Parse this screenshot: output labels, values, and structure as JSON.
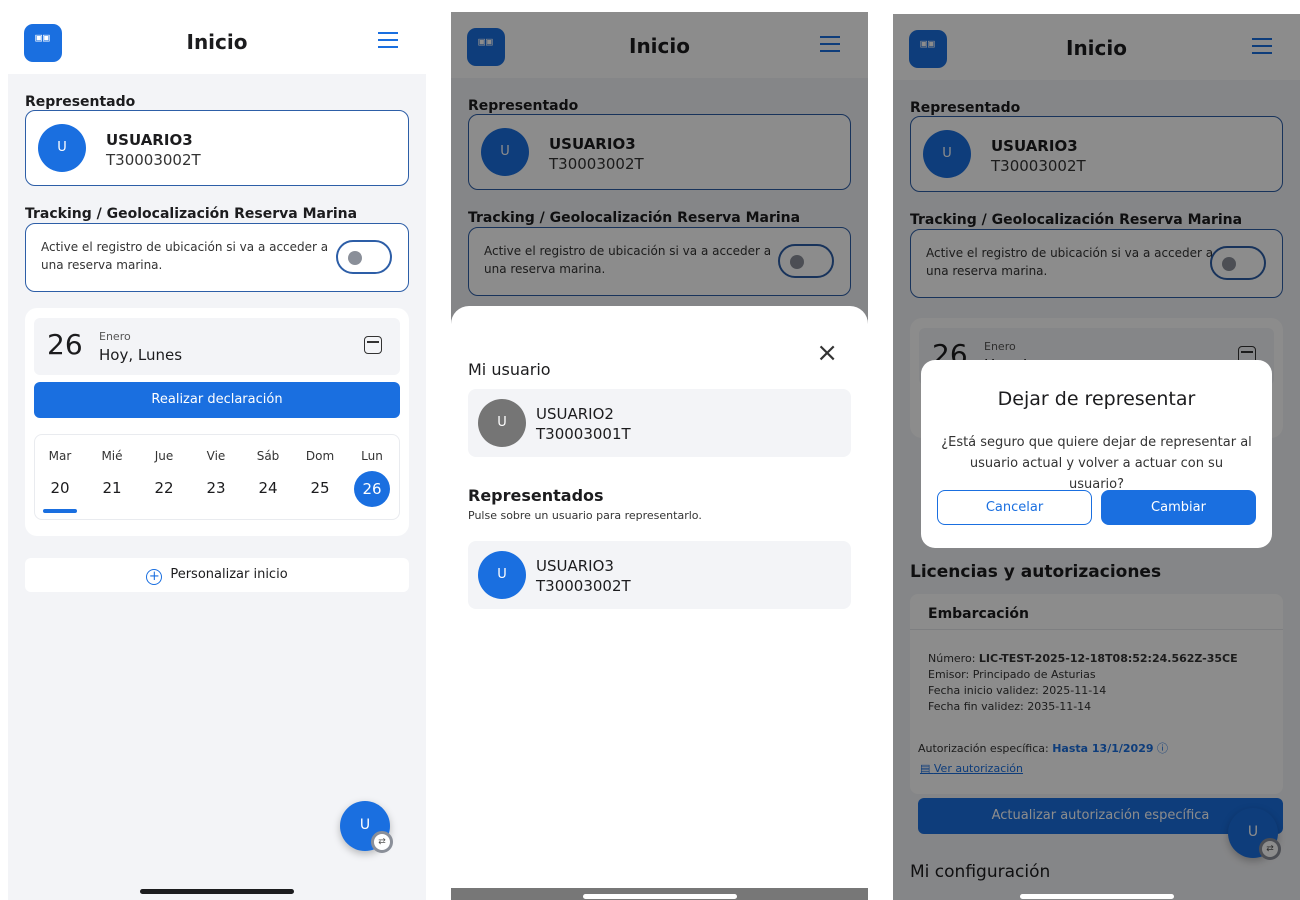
{
  "header": {
    "title": "Inicio",
    "logo_text": "OIO\nOIS"
  },
  "represented": {
    "section": "Representado",
    "avatar": "U",
    "name": "USUARIO3",
    "nif": "T30003002T"
  },
  "tracking": {
    "section": "Tracking / Geolocalización Reserva Marina",
    "text": "Active el registro de ubicación si va a acceder a una reserva marina."
  },
  "date": {
    "day_number": "26",
    "month": "Enero",
    "label": "Hoy, Lunes",
    "declare_button": "Realizar declaración",
    "week": [
      {
        "name": "Mar",
        "num": "20"
      },
      {
        "name": "Mié",
        "num": "21"
      },
      {
        "name": "Jue",
        "num": "22"
      },
      {
        "name": "Vie",
        "num": "23"
      },
      {
        "name": "Sáb",
        "num": "24"
      },
      {
        "name": "Dom",
        "num": "25"
      },
      {
        "name": "Lun",
        "num": "26"
      }
    ]
  },
  "customize": "Personalizar inicio",
  "fab": "U",
  "sheet": {
    "my_user_title": "Mi usuario",
    "my_user": {
      "avatar": "U",
      "name": "USUARIO2",
      "nif": "T30003001T"
    },
    "represented_title": "Representados",
    "represented_hint": "Pulse sobre un usuario para representarlo.",
    "represented_user": {
      "avatar": "U",
      "name": "USUARIO3",
      "nif": "T30003002T"
    },
    "close": "×"
  },
  "modal": {
    "title": "Dejar de representar",
    "text": "¿Está seguro que quiere dejar de representar al usuario actual y volver a actuar con su usuario?",
    "cancel": "Cancelar",
    "confirm": "Cambiar"
  },
  "licenses": {
    "section": "Licencias y autorizaciones",
    "type": "Embarcación",
    "number_label": "Número: ",
    "number": "LIC-TEST-2025-12-18T08:52:24.562Z-35CE",
    "issuer_label": "Emisor: ",
    "issuer": "Principado de Asturias",
    "start_label": "Fecha inicio validez: ",
    "start": "2025-11-14",
    "end_label": "Fecha fin validez: ",
    "end": "2035-11-14",
    "auth_label": "Autorización específica: ",
    "auth_value": "Hasta 13/1/2029",
    "view_auth": "Ver autorización",
    "update_button": "Actualizar autorización específica"
  },
  "my_config": "Mi configuración"
}
